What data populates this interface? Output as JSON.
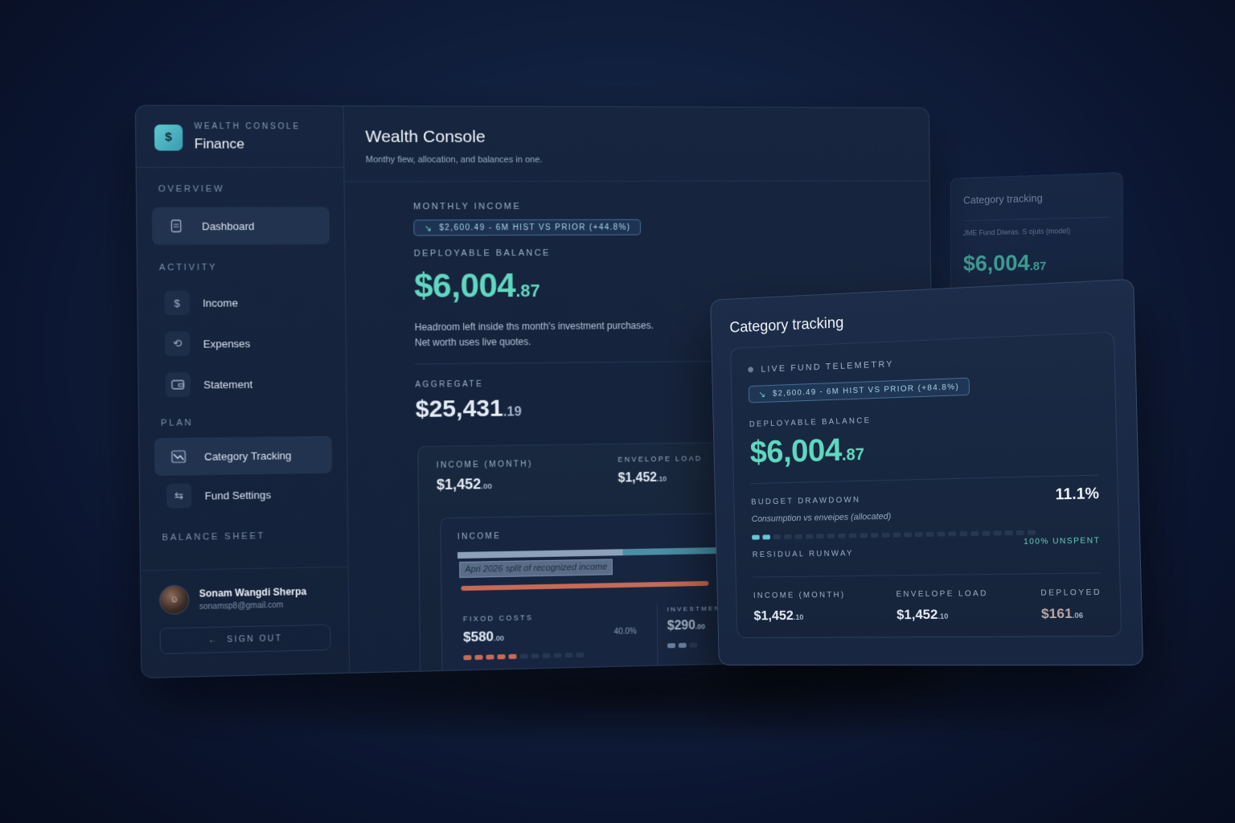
{
  "brand": {
    "kicker": "WEALTH CONSOLE",
    "name": "Finance",
    "logo_icon": "coin-icon"
  },
  "sidebar": {
    "sections": {
      "overview": "OVERVIEW",
      "activity": "ACTIVITY",
      "plan": "PLAN",
      "balance_sheet": "BALANCE SHEET"
    },
    "items": [
      {
        "label": "Dashboard",
        "icon": "document-icon"
      },
      {
        "label": "Income",
        "icon": "dollar-icon"
      },
      {
        "label": "Expenses",
        "icon": "cycle-icon"
      },
      {
        "label": "Statement",
        "icon": "wallet-icon"
      },
      {
        "label": "Category Tracking",
        "icon": "chart-icon"
      },
      {
        "label": "Fund Settings",
        "icon": "sliders-icon"
      }
    ],
    "user": {
      "name": "Sonam Wangdi Sherpa",
      "email": "sonamsp8@gmail.com",
      "signout": "SIGN OUT"
    }
  },
  "main": {
    "title": "Wealth Console",
    "subtitle": "Monthy fiew, allocation, and balances in one.",
    "monthly_income_label": "MONTHLY INCOME",
    "pill": "$2,600.49 - 6M HIST VS PRIOR  (+44.8%)",
    "deployable_label": "DEPLOYABLE BALANCE",
    "deployable_whole": "$6,004",
    "deployable_cents": ".87",
    "note_1": "Headroom left inside ths month's investment purchases.",
    "note_2": "Net worth uses live quotes.",
    "aggregate_label": "AGGREGATE",
    "aggregate_whole": "$25,431",
    "aggregate_cents": ".19",
    "income_month_label": "INCOME (MONTH)",
    "income_month_whole": "$1,452",
    "income_month_cents": ".00",
    "envelope_label": "ENVELOPE LOAD",
    "envelope_whole": "$1,452",
    "envelope_cents": ".10",
    "income_card_title": "INCOME",
    "income_card_caption": "Apri 2026 split of recognized income",
    "fixed_label": "FIXOD COSTS",
    "fixed_whole": "$580",
    "fixed_cents": ".00",
    "fixed_pct": "40.0%",
    "investment_label": "INVESTMENT",
    "investment_whole": "$290",
    "investment_cents": ".00"
  },
  "ghost": {
    "title": "Category tracking",
    "line": "JME Fund Diwras. S ojuts (model)",
    "amount_whole": "$6,004",
    "amount_cents": ".87"
  },
  "tracker": {
    "title": "Category tracking",
    "telemetry_label": "LIVE FUND TELEMETRY",
    "pill": "$2,600.49 - 6M HIST VS PRIOR (+84.8%)",
    "deployable_label": "DEPLOYABLE BALANCE",
    "deployable_whole": "$6,004",
    "deployable_cents": ".87",
    "drawdown_label": "BUDGET DRAWDOWN",
    "drawdown_pct": "11.1%",
    "drawdown_caption": "Consumption vs enveipes (allocated)",
    "unspent": "100% UNSPENT",
    "runway_label": "RESIDUAL RUNWAY",
    "income_month_label": "INCOME (MONTH)",
    "income_month_whole": "$1,452",
    "income_month_cents": ".10",
    "envelope_label": "ENVELOPE LOAD",
    "envelope_whole": "$1,452",
    "envelope_cents": ".10",
    "deployed_label": "DEPLOYED",
    "deployed_whole": "$161",
    "deployed_cents": ".06"
  },
  "colors": {
    "accent": "#5fd8bf",
    "background": "#0b1530",
    "panel": "#17253f",
    "warm": "#c86a55"
  }
}
